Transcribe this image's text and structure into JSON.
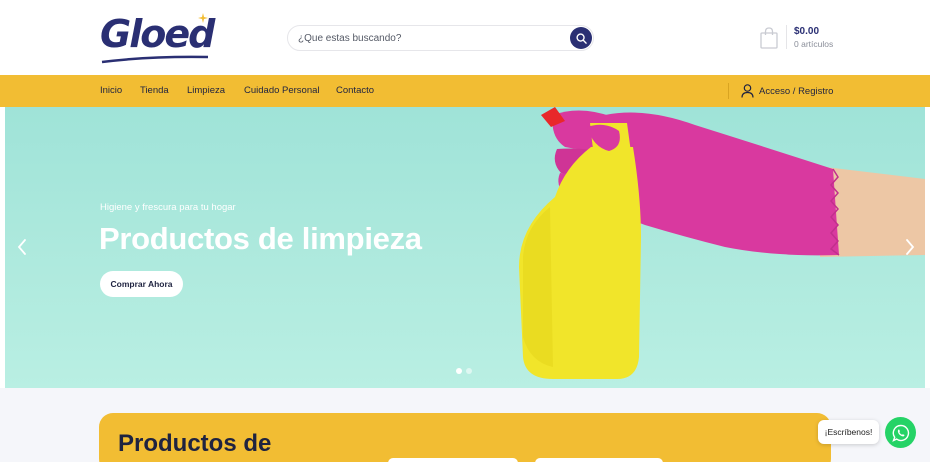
{
  "header": {
    "logo_text": "Gloed",
    "search": {
      "placeholder": "¿Que estas buscando?",
      "value": ""
    },
    "cart": {
      "total": "$0.00",
      "count": "0 artículos"
    }
  },
  "nav": {
    "items": [
      {
        "label": "Inicio"
      },
      {
        "label": "Tienda"
      },
      {
        "label": "Limpieza"
      },
      {
        "label": "Cuidado Personal"
      },
      {
        "label": "Contacto"
      }
    ],
    "account_label": "Acceso / Registro"
  },
  "hero": {
    "subtitle": "Higiene y frescura para tu hogar",
    "title": "Productos de limpieza",
    "button_label": "Comprar Ahora",
    "slide_count": 2,
    "active_slide": 1
  },
  "promo": {
    "title": "Productos de"
  },
  "chat": {
    "label": "¡Escríbenos!"
  },
  "colors": {
    "brand_navy": "#2a2f73",
    "nav_yellow": "#f2bd33",
    "hero_mint": "#ade9dd",
    "bottle_yellow": "#f1e52a",
    "glove_pink": "#d9399f",
    "whatsapp_green": "#25d366"
  },
  "icons": [
    "search-icon",
    "bag-icon",
    "user-icon",
    "chevron-left-icon",
    "chevron-right-icon",
    "whatsapp-icon"
  ]
}
